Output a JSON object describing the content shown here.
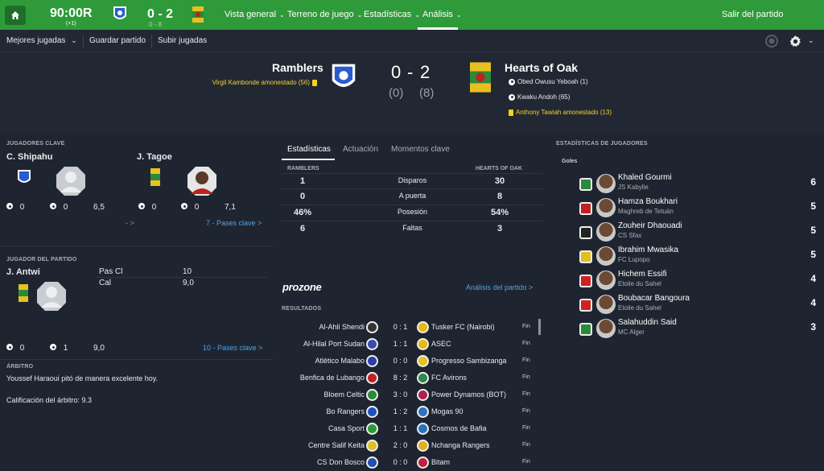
{
  "topbar": {
    "clock": "90:00R",
    "clock_sub": "(+1)",
    "score": "0 - 2",
    "score_sub": "0 - 8",
    "nav": [
      "Vista general",
      "Terreno de juego",
      "Estadísticas",
      "Análisis"
    ],
    "active_nav": "Análisis",
    "exit_label": "Salir del partido",
    "accent_color": "#2f9a3a"
  },
  "subbar": {
    "items": [
      "Mejores jugadas",
      "Guardar partido",
      "Subir jugadas"
    ]
  },
  "match": {
    "home": {
      "name": "Ramblers",
      "events": [
        {
          "text": "Virgil Kambonde amonestado (56)",
          "type": "yellow-card"
        }
      ]
    },
    "away": {
      "name": "Hearts of Oak",
      "events": [
        {
          "text": "Obed Owusu Yeboah (1)",
          "type": "goal"
        },
        {
          "text": "Kwaku Andoh (65)",
          "type": "goal"
        },
        {
          "text": "Anthony Tawiah amonestado (13)",
          "type": "yellow-card"
        }
      ]
    },
    "home_goals": "0",
    "separator": "-",
    "away_goals": "2",
    "home_xg": "(0)",
    "away_xg": "(8)"
  },
  "key_players": {
    "title": "JUGADORES CLAVE",
    "home": {
      "name": "C. Shipahu",
      "goals": "0",
      "assists": "0",
      "rating": "6,5",
      "link": "- >"
    },
    "away": {
      "name": "J. Tagoe",
      "goals": "0",
      "assists": "0",
      "rating": "7,1",
      "link": "7 - Pases clave >"
    }
  },
  "player_of_match": {
    "title": "JUGADOR DEL PARTIDO",
    "name": "J. Antwi",
    "stat1_label": "Pas Cl",
    "stat1_value": "10",
    "stat2_label": "Cal",
    "stat2_value": "9,0",
    "goals": "0",
    "assists": "1",
    "rating": "9,0",
    "link": "10 - Pases clave >"
  },
  "referee": {
    "title": "ÁRBITRO",
    "comment": "Youssef Haraoui pitó de manera excelente hoy.",
    "rating": "Calificación del árbitro: 9.3"
  },
  "stats_panel": {
    "tabs": [
      "Estadísticas",
      "Actuación",
      "Momentos clave"
    ],
    "home_label": "RAMBLERS",
    "away_label": "HEARTS OF OAK",
    "rows": [
      {
        "home": "1",
        "label": "Disparos",
        "away": "30"
      },
      {
        "home": "0",
        "label": "A puerta",
        "away": "8"
      },
      {
        "home": "46%",
        "label": "Posesión",
        "away": "54%"
      },
      {
        "home": "6",
        "label": "Faltas",
        "away": "3"
      }
    ],
    "prozone": "prozone",
    "analysis_link": "Análisis del partido >"
  },
  "results": {
    "title": "RESULTADOS",
    "rows": [
      {
        "home": "Al-Ahli Shendi",
        "score": "0 : 1",
        "away": "Tusker FC (Nairobi)",
        "status": "Fin",
        "hc": "#333",
        "ac": "#e8b910"
      },
      {
        "home": "Al-Hilal Port Sudan",
        "score": "1 : 1",
        "away": "ASEC",
        "status": "Fin",
        "hc": "#3a4ab0",
        "ac": "#e8b910"
      },
      {
        "home": "Atlético Malabo",
        "score": "0 : 0",
        "away": "Progresso Sambizanga",
        "status": "Fin",
        "hc": "#2a3fa8",
        "ac": "#e8c020"
      },
      {
        "home": "Benfica de Lubango",
        "score": "8 : 2",
        "away": "FC Avirons",
        "status": "Fin",
        "hc": "#c02020",
        "ac": "#2a8a4a"
      },
      {
        "home": "Bloem Celtic",
        "score": "3 : 0",
        "away": "Power Dynamos (BOT)",
        "status": "Fin",
        "hc": "#2a8a3a",
        "ac": "#b02050"
      },
      {
        "home": "Bo Rangers",
        "score": "1 : 2",
        "away": "Mogas 90",
        "status": "Fin",
        "hc": "#2050c0",
        "ac": "#3070c0"
      },
      {
        "home": "Casa Sport",
        "score": "1 : 1",
        "away": "Cosmos de Bafia",
        "status": "Fin",
        "hc": "#2a9a3a",
        "ac": "#2a70c0"
      },
      {
        "home": "Centre Salif Keita",
        "score": "2 : 0",
        "away": "Nchanga Rangers",
        "status": "Fin",
        "hc": "#e0c020",
        "ac": "#e0b020"
      },
      {
        "home": "CS Don Bosco",
        "score": "0 : 0",
        "away": "Bitam",
        "status": "Fin",
        "hc": "#2050b0",
        "ac": "#c02040"
      }
    ]
  },
  "player_stats": {
    "title": "ESTADÍSTICAS DE JUGADORES",
    "section": "Goles",
    "scorers": [
      {
        "name": "Khaled Gourmi",
        "club": "JS Kabylie",
        "goals": "6",
        "cc": "#2a8a3a"
      },
      {
        "name": "Hamza Boukhari",
        "club": "Maghreb de Tetuán",
        "goals": "5",
        "cc": "#c02020"
      },
      {
        "name": "Zouheir Dhaouadi",
        "club": "CS Sfax",
        "goals": "5",
        "cc": "#222"
      },
      {
        "name": "Ibrahim Mwasika",
        "club": "FC Lupopo",
        "goals": "5",
        "cc": "#e0c020"
      },
      {
        "name": "Hichem Essifi",
        "club": "Etoile du Sahel",
        "goals": "4",
        "cc": "#d02020"
      },
      {
        "name": "Boubacar Bangoura",
        "club": "Etoile du Sahel",
        "goals": "4",
        "cc": "#d02020"
      },
      {
        "name": "Salahuddin Said",
        "club": "MC Alger",
        "goals": "3",
        "cc": "#2a8a3a"
      }
    ]
  }
}
